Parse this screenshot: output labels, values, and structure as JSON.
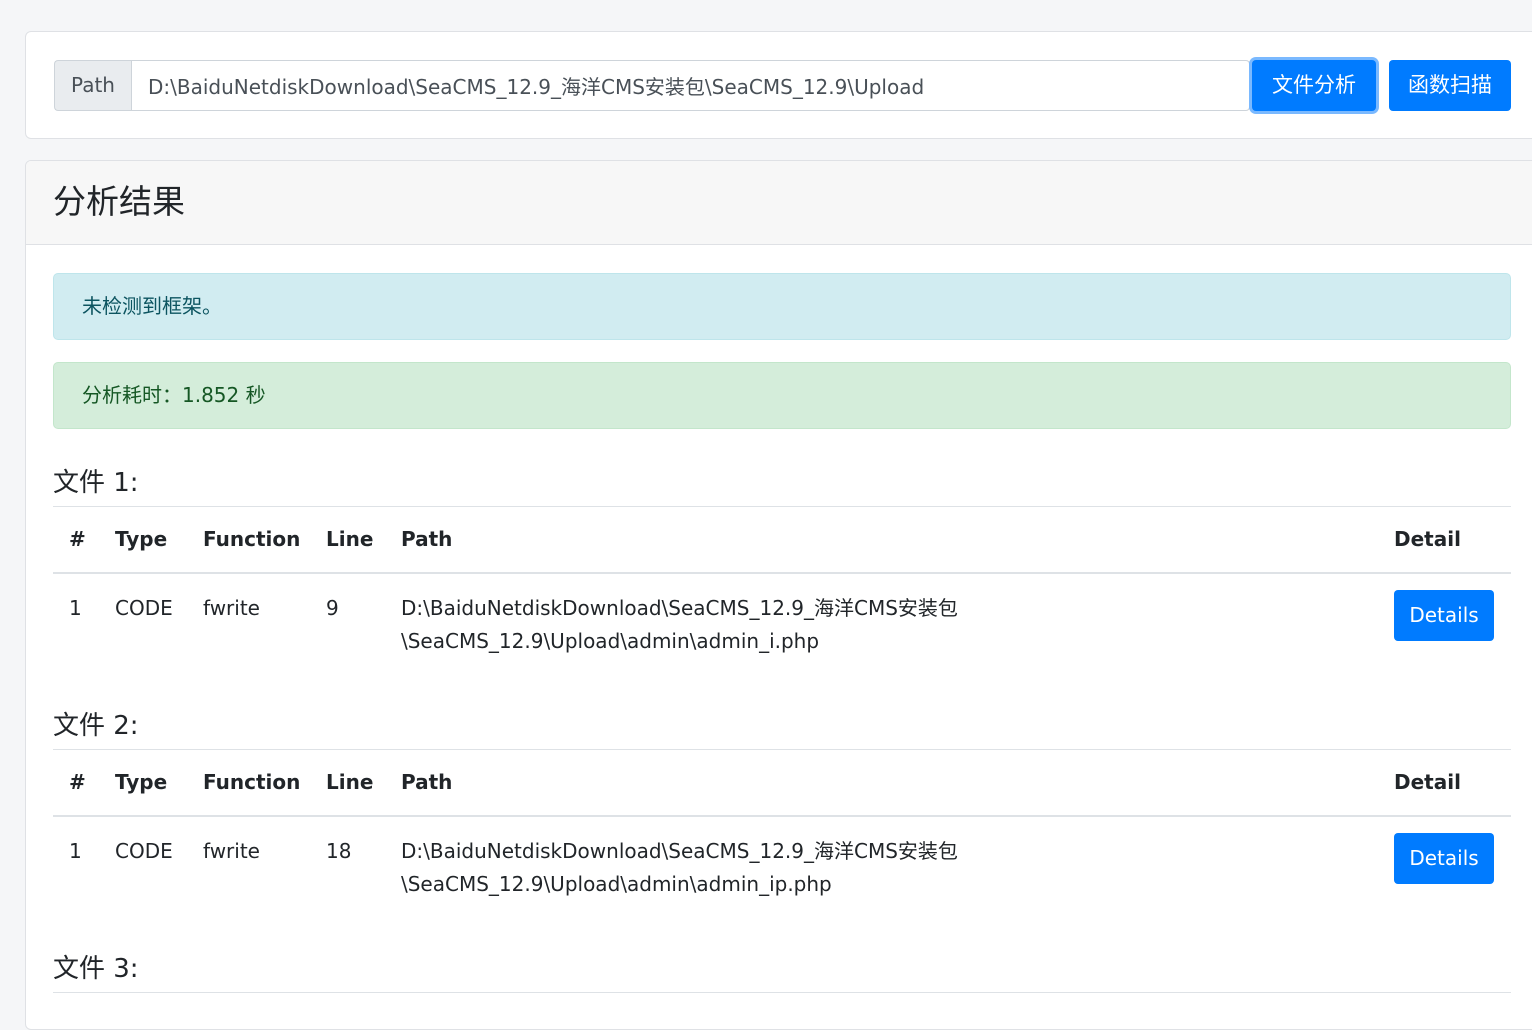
{
  "search": {
    "prefix": "Path",
    "value": "D:\\BaiduNetdiskDownload\\SeaCMS_12.9_海洋CMS安装包\\SeaCMS_12.9\\Upload",
    "analyze_label": "文件分析",
    "scan_label": "函数扫描"
  },
  "results": {
    "title": "分析结果",
    "info_message": "未检测到框架。",
    "timing_message": "分析耗时：1.852 秒"
  },
  "table_headers": {
    "num": "#",
    "type": "Type",
    "function": "Function",
    "line": "Line",
    "path": "Path",
    "detail": "Detail"
  },
  "files": [
    {
      "title": "文件 1:",
      "rows": [
        {
          "num": "1",
          "type": "CODE",
          "function": "fwrite",
          "line": "9",
          "path_line1": "D:\\BaiduNetdiskDownload\\SeaCMS_12.9_海洋CMS安装包",
          "path_line2": "\\SeaCMS_12.9\\Upload\\admin\\admin_i.php",
          "detail_label": "Details"
        }
      ]
    },
    {
      "title": "文件 2:",
      "rows": [
        {
          "num": "1",
          "type": "CODE",
          "function": "fwrite",
          "line": "18",
          "path_line1": "D:\\BaiduNetdiskDownload\\SeaCMS_12.9_海洋CMS安装包",
          "path_line2": "\\SeaCMS_12.9\\Upload\\admin\\admin_ip.php",
          "detail_label": "Details"
        }
      ]
    },
    {
      "title": "文件 3:",
      "rows": []
    }
  ],
  "colors": {
    "primary": "#007bff",
    "info_bg": "#d1ecf1",
    "success_bg": "#d4edda"
  }
}
